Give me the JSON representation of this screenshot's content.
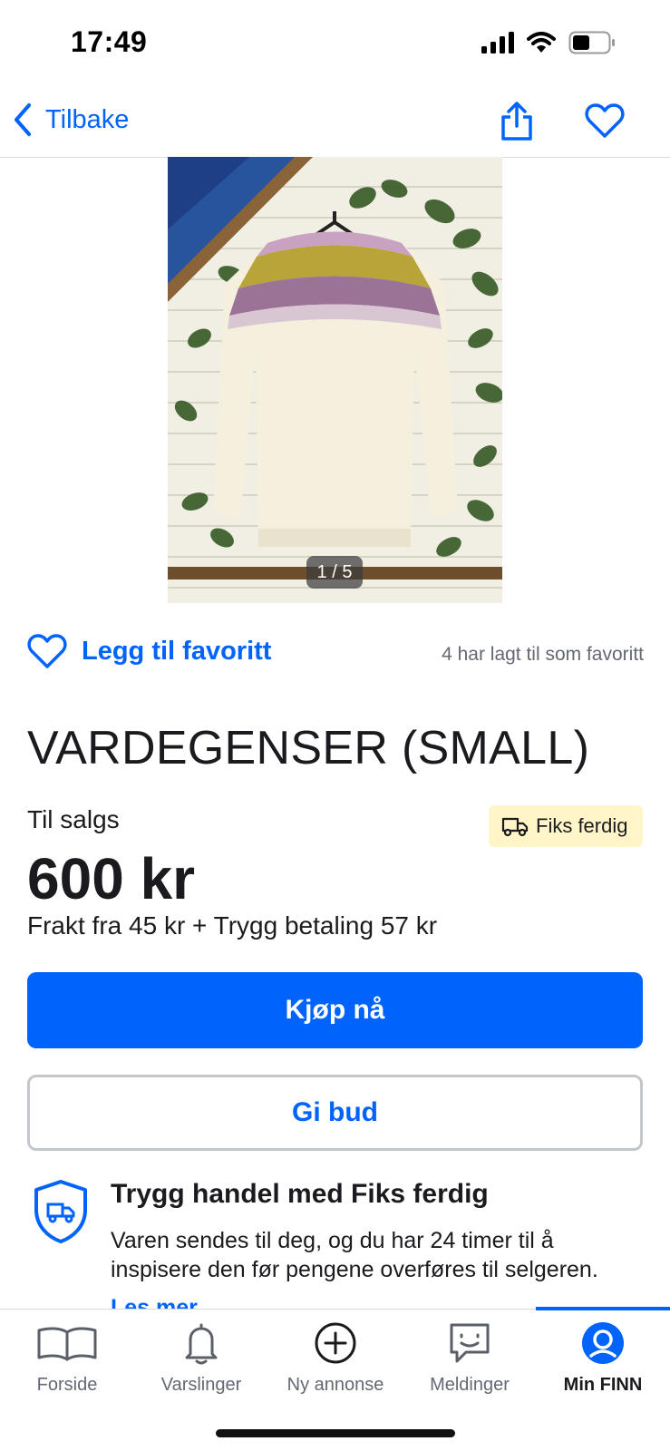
{
  "status_bar": {
    "time": "17:49",
    "icons": [
      "signal-icon",
      "wifi-icon",
      "battery-icon"
    ]
  },
  "nav": {
    "back_label": "Tilbake",
    "icons": [
      "chevron-left-icon",
      "share-icon",
      "heart-icon"
    ]
  },
  "gallery": {
    "counter": "1 / 5"
  },
  "favorite": {
    "label": "Legg til favoritt",
    "count_text": "4 har lagt til som favoritt"
  },
  "listing": {
    "title": "VARDEGENSER (SMALL)",
    "sale_label": "Til salgs",
    "badge": "Fiks ferdig",
    "price": "600 kr",
    "shipping": "Frakt fra 45 kr + Trygg betaling 57 kr"
  },
  "actions": {
    "buy": "Kjøp nå",
    "bid": "Gi bud"
  },
  "trust": {
    "title": "Trygg handel med Fiks ferdig",
    "text": "Varen sendes til deg, og du har 24 timer til å inspisere den før pengene overføres til selgeren.",
    "link": "Les mer"
  },
  "tabs": [
    {
      "label": "Forside",
      "icon": "book-icon"
    },
    {
      "label": "Varslinger",
      "icon": "bell-icon"
    },
    {
      "label": "Ny annonse",
      "icon": "plus-circle-icon"
    },
    {
      "label": "Meldinger",
      "icon": "chat-icon"
    },
    {
      "label": "Min FINN",
      "icon": "profile-icon"
    }
  ],
  "active_tab": "Min FINN",
  "colors": {
    "accent": "#0063fb",
    "badge_bg": "#fff5c8",
    "text": "#1b1b1f",
    "muted": "#646872"
  }
}
